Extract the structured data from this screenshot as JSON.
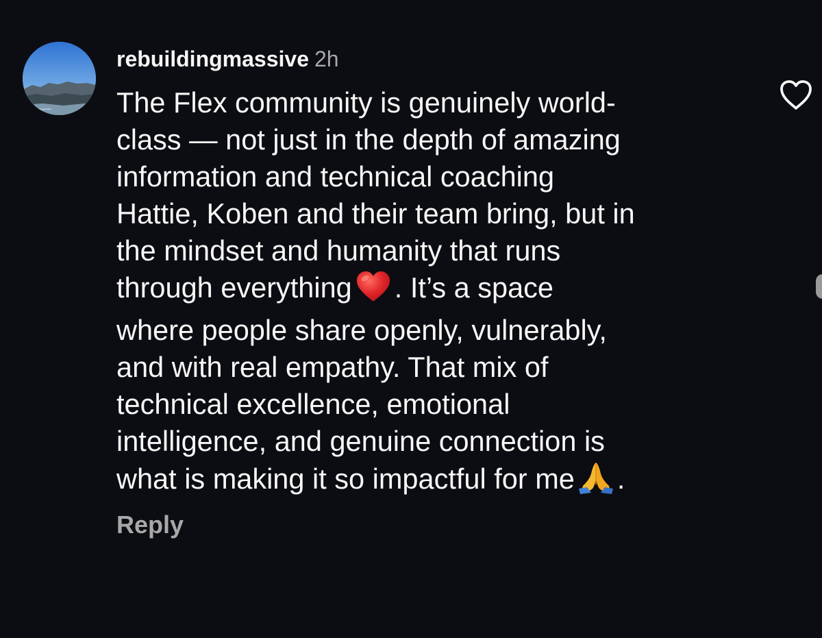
{
  "comment": {
    "username": "rebuildingmassive",
    "timestamp": "2h",
    "lines": [
      "The Flex community is genuinely world-",
      "class — not just in the depth of amazing",
      "information and technical coaching",
      "Hattie, Koben and their team bring, but in",
      "the mindset and humanity that runs",
      "through everything",
      ". It’s a space",
      "where people share openly, vulnerably,",
      "and with real empathy. That mix of",
      "technical excellence, emotional",
      "intelligence, and genuine connection is",
      "what is making it so impactful for me",
      "."
    ],
    "reply_label": "Reply"
  },
  "icons": {
    "like": "heart-outline-icon",
    "heart_emoji": "red-heart-emoji",
    "pray_emoji": "folded-hands-emoji"
  },
  "colors": {
    "background": "#0c0d12",
    "text": "#f7f7f7",
    "muted": "#a8a8a8",
    "heart_emoji": "#e0262a"
  }
}
